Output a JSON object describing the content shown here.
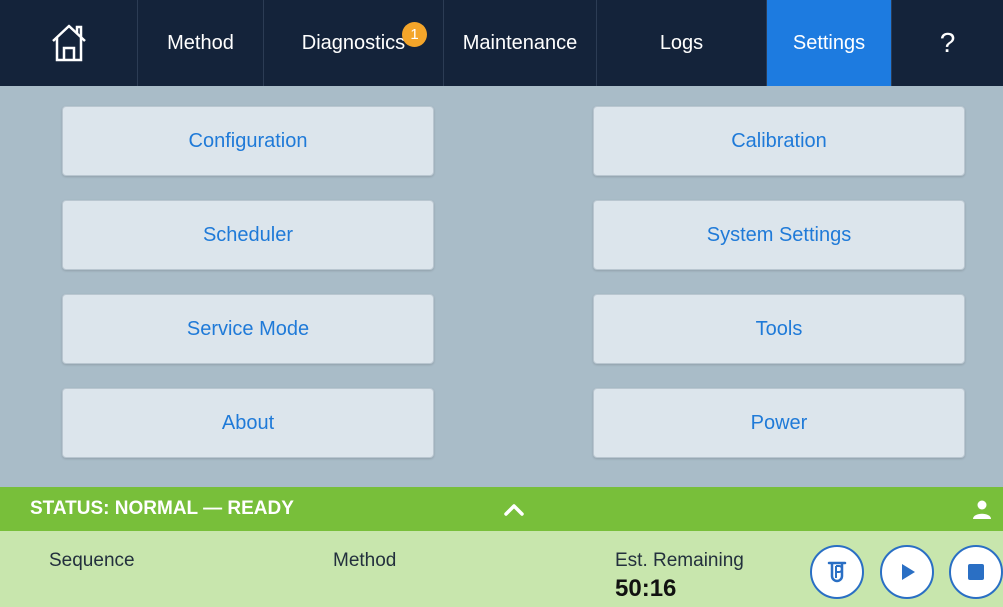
{
  "nav": {
    "home_icon": "home-icon",
    "method": "Method",
    "diagnostics": "Diagnostics",
    "diagnostics_badge": "1",
    "maintenance": "Maintenance",
    "logs": "Logs",
    "settings": "Settings",
    "help": "?"
  },
  "menu": {
    "configuration": "Configuration",
    "calibration": "Calibration",
    "scheduler": "Scheduler",
    "system_settings": "System Settings",
    "service_mode": "Service Mode",
    "tools": "Tools",
    "about": "About",
    "power": "Power"
  },
  "status": {
    "text": "STATUS: NORMAL — READY",
    "color": "#78bf3a"
  },
  "info": {
    "sequence_label": "Sequence",
    "method_label": "Method",
    "remaining_label": "Est. Remaining",
    "remaining_value": "50:16"
  },
  "colors": {
    "accent": "#1d7be0",
    "badge": "#f4a52a",
    "nav_bg": "#14233a"
  }
}
